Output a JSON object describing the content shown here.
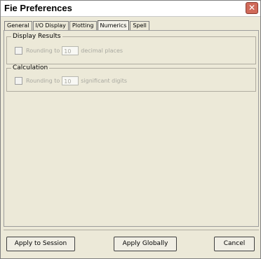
{
  "window": {
    "title": "Fie Preferences"
  },
  "tabs": [
    {
      "label": "General",
      "active": false
    },
    {
      "label": "I/O Display",
      "active": false
    },
    {
      "label": "Plotting",
      "active": false
    },
    {
      "label": "Numerics",
      "active": true
    },
    {
      "label": "Spell",
      "active": false
    }
  ],
  "display_results": {
    "legend": "Display Results",
    "checked": false,
    "prefix": "Rounding to",
    "value": "10",
    "suffix": "decimal places"
  },
  "calculation": {
    "legend": "Calculation",
    "checked": false,
    "prefix": "Rounding to",
    "value": "10",
    "suffix": "significant digits"
  },
  "buttons": {
    "apply_session": "Apply to Session",
    "apply_globally": "Apply Globally",
    "cancel": "Cancel"
  }
}
